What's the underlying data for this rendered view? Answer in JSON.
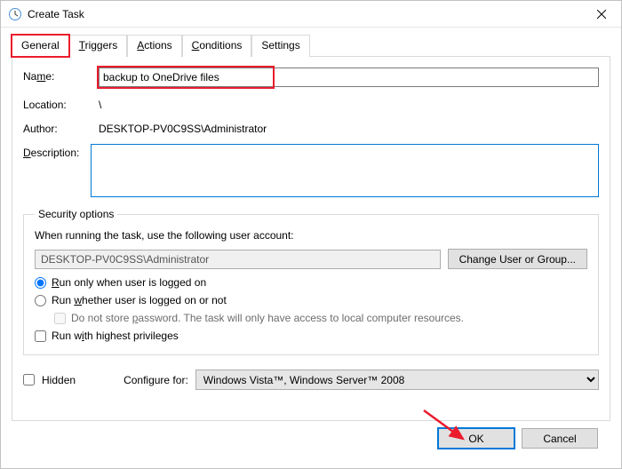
{
  "window": {
    "title": "Create Task"
  },
  "tabs": {
    "general": "General",
    "triggers": "Triggers",
    "actions": "Actions",
    "conditions": "Conditions",
    "settings": "Settings"
  },
  "labels": {
    "name": "Name:",
    "location": "Location:",
    "author": "Author:",
    "description": "Description:",
    "hidden": "Hidden",
    "configure_for": "Configure for:"
  },
  "fields": {
    "name": "backup to OneDrive files",
    "location": "\\",
    "author": "DESKTOP-PV0C9SS\\Administrator",
    "description": ""
  },
  "security": {
    "legend": "Security options",
    "prompt": "When running the task, use the following user account:",
    "user": "DESKTOP-PV0C9SS\\Administrator",
    "change_btn": "Change User or Group...",
    "run_logged_on": "Run only when user is logged on",
    "run_whether": "Run whether user is logged on or not",
    "no_store": "Do not store password.  The task will only have access to local computer resources.",
    "highest": "Run with highest privileges"
  },
  "configure": {
    "selected": "Windows Vista™, Windows Server™ 2008"
  },
  "buttons": {
    "ok": "OK",
    "cancel": "Cancel"
  }
}
